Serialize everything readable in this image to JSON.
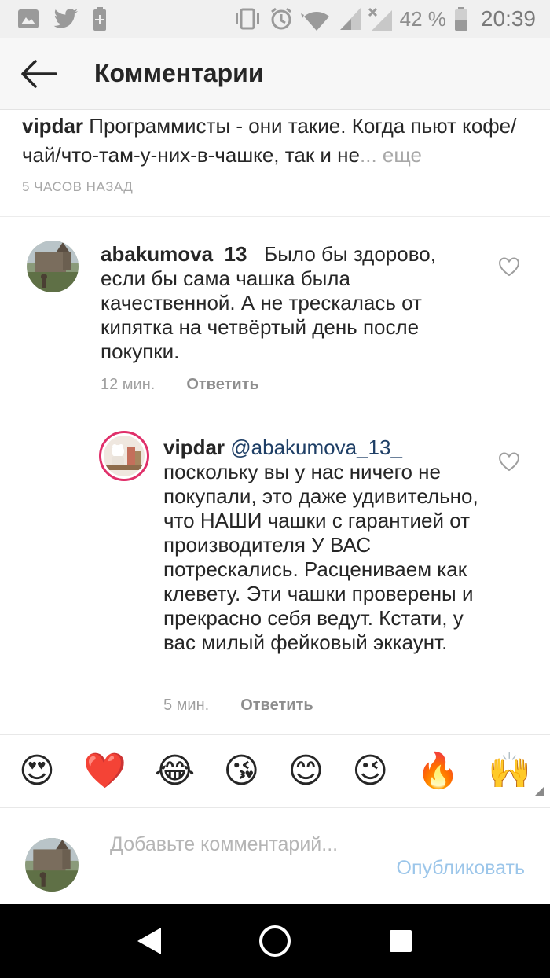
{
  "status_bar": {
    "battery_percent": "42 %",
    "time": "20:39",
    "icons": [
      "gallery-icon",
      "twitter-icon",
      "battery-saver-icon",
      "vibrate-icon",
      "alarm-icon",
      "wifi-icon",
      "signal-icon",
      "signal-no-icon",
      "battery-icon"
    ]
  },
  "header": {
    "title": "Комментарии"
  },
  "caption": {
    "user": "vipdar",
    "text": " Программисты - они такие. Когда пьют кофе/чай/что-там-у-них-в-чашке, так и не",
    "ellipsis": "...",
    "more": " еще",
    "time": "5 часов назад"
  },
  "comments": [
    {
      "user": "abakumova_13_",
      "text": " Было бы здорово, если бы сама чашка была качественной. А не трескалась от кипятка на четвёртый день после покупки.",
      "time": "12 мин.",
      "reply": "Ответить"
    },
    {
      "user": "vipdar",
      "mention": "@abakumova_13_",
      "text": " поскольку вы у нас ничего не покупали, это даже удивительно, что НАШИ чашки с гарантией от производителя У ВАС потрескались. Расцениваем как клевету. Эти чашки проверены и прекрасно себя ведут. Кстати, у вас милый фейковый эккаунт.",
      "time": "5 мин.",
      "reply": "Ответить"
    }
  ],
  "emoji_bar": [
    "😍",
    "❤️",
    "😂",
    "😘",
    "😊",
    "😉",
    "🔥",
    "🙌"
  ],
  "input": {
    "placeholder": "Добавьте комментарий...",
    "publish": "Опубликовать"
  },
  "colors": {
    "header_bg": "#f7f7f7",
    "status_bg": "#f0f0f0",
    "publish_disabled": "#9cc6ea",
    "story_ring": "#e0306a",
    "nav_bg": "#000000"
  }
}
